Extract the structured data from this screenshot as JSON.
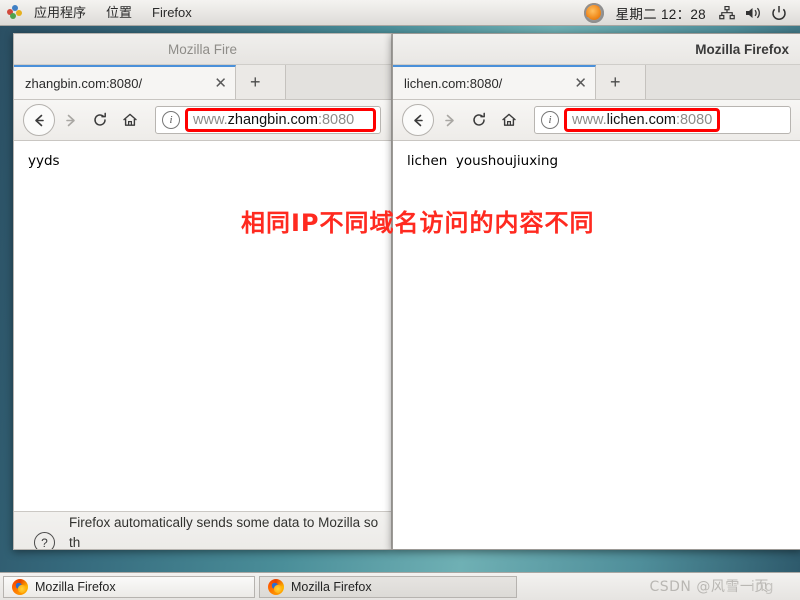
{
  "top_panel": {
    "apps_menu": "应用程序",
    "places_menu": "位置",
    "app_menu": "Firefox",
    "apps_icon": "applications-grid-icon",
    "clock_weekday": "星期二",
    "clock_time": "12：28",
    "tray_icons": [
      "firefox-circle-icon",
      "network-icon",
      "volume-icon",
      "power-icon"
    ]
  },
  "windows": {
    "left": {
      "title": "Mozilla Fire",
      "tab": {
        "label": "zhangbin.com:8080/",
        "close": "✕"
      },
      "newtab_label": "+",
      "nav": {
        "back": "←",
        "forward": "→",
        "reload": "⟳",
        "home": "⌂"
      },
      "url": {
        "info_icon": "ⓘ",
        "scheme_prefix": "www.",
        "host": "zhangbin.com",
        "port": ":8080",
        "highlight_color": "#ff0000"
      },
      "page_text": "yyds",
      "notification": {
        "icon": "?",
        "text": "Firefox automatically sends some data to Mozilla so th\nimprove your experience."
      }
    },
    "right": {
      "title": "Mozilla Firefox",
      "tab": {
        "label": "lichen.com:8080/",
        "close": "✕"
      },
      "newtab_label": "+",
      "nav": {
        "back": "←",
        "forward": "→",
        "reload": "⟳",
        "home": "⌂"
      },
      "url": {
        "info_icon": "ⓘ",
        "scheme_prefix": "www.",
        "host": "lichen.com",
        "port": ":8080",
        "highlight_color": "#ff0000"
      },
      "page_text": "lichen  youshoujiuxing"
    }
  },
  "annotation": {
    "text": "相同IP不同域名访问的内容不同",
    "color": "#ff2a20"
  },
  "taskbar": {
    "items": [
      {
        "label": "Mozilla Firefox",
        "icon": "firefox-icon"
      },
      {
        "label": "Mozilla Firefox",
        "icon": "firefox-icon"
      }
    ]
  },
  "watermark": {
    "text": "CSDN @风雪一页",
    "overlap_text": "ing"
  }
}
